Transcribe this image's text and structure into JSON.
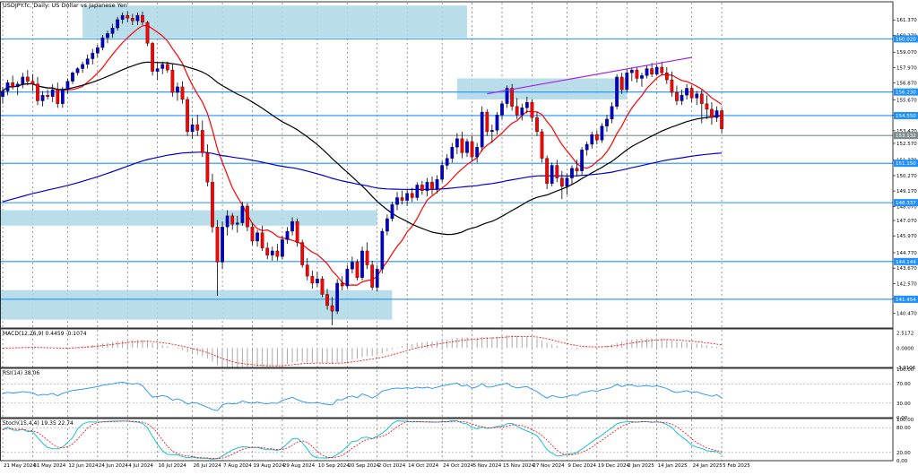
{
  "chart_data": {
    "type": "candlestick",
    "title": "USDJPY.fc, Daily: US Dollar vs Japanese Yen",
    "x_ticks": [
      "21 May 2024",
      "31 May 2024",
      "12 Jun 2024",
      "24 Jun 2024",
      "4 Jul 2024",
      "16 Jul 2024",
      "26 Jul 2024",
      "7 Aug 2024",
      "19 Aug 2024",
      "29 Aug 2024",
      "10 Sep 2024",
      "20 Sep 2024",
      "2 Oct 2024",
      "14 Oct 2024",
      "24 Oct 2024",
      "5 Nov 2024",
      "15 Nov 2024",
      "27 Nov 2024",
      "9 Dec 2024",
      "19 Dec 2024",
      "2 Jan 2025",
      "14 Jan 2025",
      "24 Jan 2025",
      "5 Feb 2025"
    ],
    "price_axis": {
      "ylim": [
        139.4,
        162.6
      ],
      "ticks": [
        "161.370",
        "160.270",
        "159.070",
        "157.970",
        "156.870",
        "155.670",
        "154.570",
        "153.470",
        "152.570",
        "151.370",
        "150.270",
        "149.170",
        "148.070",
        "147.070",
        "145.970",
        "144.770",
        "143.670",
        "142.570",
        "141.470",
        "140.470"
      ],
      "tagged_levels": [
        {
          "value": 160.02,
          "label": "160.020",
          "color": "#1e90ff"
        },
        {
          "value": 156.23,
          "label": "156.230",
          "color": "#1e90ff"
        },
        {
          "value": 154.55,
          "label": "154.550",
          "color": "#1e90ff"
        },
        {
          "value": 153.13,
          "label": "153.132",
          "color": "#7f8c8d"
        },
        {
          "value": 151.15,
          "label": "151.150",
          "color": "#1e90ff"
        },
        {
          "value": 148.34,
          "label": "148.337",
          "color": "#1e90ff"
        },
        {
          "value": 144.14,
          "label": "144.144",
          "color": "#1e90ff"
        },
        {
          "value": 141.45,
          "label": "141.454",
          "color": "#1e90ff"
        }
      ]
    },
    "zones": [
      {
        "from_idx": 16,
        "to_idx": 93,
        "low": 160.1,
        "high": 162.4
      },
      {
        "from_idx": -1,
        "to_idx": 75,
        "low": 146.7,
        "high": 147.8
      },
      {
        "from_idx": -1,
        "to_idx": 78,
        "low": 140.0,
        "high": 142.1
      },
      {
        "from_idx": 91,
        "to_idx": 125,
        "low": 155.7,
        "high": 157.2
      }
    ],
    "trendline": {
      "from_idx": 97,
      "from_value": 156.1,
      "to_idx": 138,
      "to_value": 158.7,
      "color": "#a020f0"
    },
    "candles": [
      {
        "o": 155.9,
        "h": 156.6,
        "l": 155.4,
        "c": 156.3
      },
      {
        "o": 156.3,
        "h": 157.1,
        "l": 156.0,
        "c": 156.9
      },
      {
        "o": 156.9,
        "h": 157.4,
        "l": 156.4,
        "c": 156.6
      },
      {
        "o": 156.6,
        "h": 157.0,
        "l": 156.0,
        "c": 156.8
      },
      {
        "o": 156.8,
        "h": 157.6,
        "l": 156.5,
        "c": 157.3
      },
      {
        "o": 157.3,
        "h": 157.8,
        "l": 156.7,
        "c": 157.0
      },
      {
        "o": 157.0,
        "h": 157.5,
        "l": 156.3,
        "c": 156.8
      },
      {
        "o": 156.8,
        "h": 157.3,
        "l": 155.3,
        "c": 155.6
      },
      {
        "o": 155.6,
        "h": 156.3,
        "l": 155.2,
        "c": 156.0
      },
      {
        "o": 156.0,
        "h": 156.4,
        "l": 155.7,
        "c": 155.9
      },
      {
        "o": 155.9,
        "h": 156.8,
        "l": 155.5,
        "c": 156.4
      },
      {
        "o": 156.4,
        "h": 156.9,
        "l": 155.1,
        "c": 155.4
      },
      {
        "o": 155.4,
        "h": 156.6,
        "l": 155.1,
        "c": 156.4
      },
      {
        "o": 156.4,
        "h": 157.2,
        "l": 156.1,
        "c": 157.0
      },
      {
        "o": 157.0,
        "h": 157.7,
        "l": 156.8,
        "c": 157.6
      },
      {
        "o": 157.6,
        "h": 158.0,
        "l": 157.4,
        "c": 157.9
      },
      {
        "o": 157.9,
        "h": 158.4,
        "l": 157.6,
        "c": 158.2
      },
      {
        "o": 158.2,
        "h": 158.9,
        "l": 157.9,
        "c": 158.6
      },
      {
        "o": 158.6,
        "h": 159.3,
        "l": 158.2,
        "c": 159.0
      },
      {
        "o": 159.0,
        "h": 159.6,
        "l": 158.7,
        "c": 159.4
      },
      {
        "o": 159.4,
        "h": 160.3,
        "l": 159.2,
        "c": 160.1
      },
      {
        "o": 160.1,
        "h": 160.6,
        "l": 159.7,
        "c": 160.4
      },
      {
        "o": 160.4,
        "h": 161.1,
        "l": 160.1,
        "c": 160.8
      },
      {
        "o": 160.8,
        "h": 161.6,
        "l": 160.6,
        "c": 161.4
      },
      {
        "o": 161.4,
        "h": 161.9,
        "l": 161.1,
        "c": 161.7
      },
      {
        "o": 161.7,
        "h": 162.0,
        "l": 161.2,
        "c": 161.5
      },
      {
        "o": 161.5,
        "h": 161.8,
        "l": 161.0,
        "c": 161.3
      },
      {
        "o": 161.3,
        "h": 161.9,
        "l": 161.0,
        "c": 161.7
      },
      {
        "o": 161.7,
        "h": 161.95,
        "l": 161.0,
        "c": 161.2
      },
      {
        "o": 161.2,
        "h": 161.3,
        "l": 159.5,
        "c": 159.7
      },
      {
        "o": 159.7,
        "h": 159.8,
        "l": 157.4,
        "c": 157.7
      },
      {
        "o": 157.7,
        "h": 158.3,
        "l": 157.1,
        "c": 157.9
      },
      {
        "o": 157.9,
        "h": 158.4,
        "l": 157.5,
        "c": 158.2
      },
      {
        "o": 158.2,
        "h": 158.4,
        "l": 157.6,
        "c": 157.8
      },
      {
        "o": 157.8,
        "h": 158.2,
        "l": 155.9,
        "c": 156.2
      },
      {
        "o": 156.2,
        "h": 156.9,
        "l": 155.6,
        "c": 156.6
      },
      {
        "o": 156.6,
        "h": 157.0,
        "l": 155.4,
        "c": 155.7
      },
      {
        "o": 155.7,
        "h": 155.9,
        "l": 153.1,
        "c": 153.4
      },
      {
        "o": 153.4,
        "h": 154.4,
        "l": 152.9,
        "c": 153.9
      },
      {
        "o": 153.9,
        "h": 154.6,
        "l": 153.1,
        "c": 153.5
      },
      {
        "o": 153.5,
        "h": 154.2,
        "l": 151.6,
        "c": 151.9
      },
      {
        "o": 151.9,
        "h": 152.5,
        "l": 149.5,
        "c": 149.8
      },
      {
        "o": 149.8,
        "h": 150.4,
        "l": 146.2,
        "c": 146.6
      },
      {
        "o": 146.6,
        "h": 147.1,
        "l": 141.7,
        "c": 144.1
      },
      {
        "o": 144.1,
        "h": 147.0,
        "l": 143.6,
        "c": 146.6
      },
      {
        "o": 146.6,
        "h": 147.8,
        "l": 146.0,
        "c": 147.4
      },
      {
        "o": 147.4,
        "h": 147.6,
        "l": 146.4,
        "c": 146.8
      },
      {
        "o": 146.8,
        "h": 147.4,
        "l": 146.2,
        "c": 146.9
      },
      {
        "o": 146.9,
        "h": 148.4,
        "l": 146.7,
        "c": 148.1
      },
      {
        "o": 148.1,
        "h": 148.3,
        "l": 146.3,
        "c": 146.6
      },
      {
        "o": 146.6,
        "h": 146.9,
        "l": 145.3,
        "c": 145.6
      },
      {
        "o": 145.6,
        "h": 146.4,
        "l": 145.2,
        "c": 146.2
      },
      {
        "o": 146.2,
        "h": 146.7,
        "l": 144.9,
        "c": 145.1
      },
      {
        "o": 145.1,
        "h": 145.5,
        "l": 144.3,
        "c": 144.6
      },
      {
        "o": 144.6,
        "h": 145.2,
        "l": 144.2,
        "c": 144.9
      },
      {
        "o": 144.9,
        "h": 145.4,
        "l": 144.2,
        "c": 144.5
      },
      {
        "o": 144.5,
        "h": 146.0,
        "l": 144.3,
        "c": 145.7
      },
      {
        "o": 145.7,
        "h": 146.6,
        "l": 145.4,
        "c": 146.3
      },
      {
        "o": 146.3,
        "h": 147.3,
        "l": 146.0,
        "c": 147.0
      },
      {
        "o": 147.0,
        "h": 147.2,
        "l": 145.2,
        "c": 145.5
      },
      {
        "o": 145.5,
        "h": 145.7,
        "l": 143.7,
        "c": 143.9
      },
      {
        "o": 143.9,
        "h": 144.4,
        "l": 142.8,
        "c": 143.1
      },
      {
        "o": 143.1,
        "h": 143.5,
        "l": 142.2,
        "c": 142.6
      },
      {
        "o": 142.6,
        "h": 143.4,
        "l": 142.3,
        "c": 142.9
      },
      {
        "o": 142.9,
        "h": 143.1,
        "l": 141.6,
        "c": 141.8
      },
      {
        "o": 141.8,
        "h": 142.2,
        "l": 140.7,
        "c": 141.0
      },
      {
        "o": 141.0,
        "h": 141.6,
        "l": 139.6,
        "c": 140.6
      },
      {
        "o": 140.6,
        "h": 142.9,
        "l": 140.4,
        "c": 142.6
      },
      {
        "o": 142.6,
        "h": 143.1,
        "l": 142.1,
        "c": 142.4
      },
      {
        "o": 142.4,
        "h": 143.9,
        "l": 142.2,
        "c": 143.6
      },
      {
        "o": 143.6,
        "h": 144.5,
        "l": 143.3,
        "c": 144.1
      },
      {
        "o": 144.1,
        "h": 144.3,
        "l": 142.8,
        "c": 143.0
      },
      {
        "o": 143.0,
        "h": 145.2,
        "l": 142.8,
        "c": 144.9
      },
      {
        "o": 144.9,
        "h": 145.5,
        "l": 143.6,
        "c": 143.9
      },
      {
        "o": 143.9,
        "h": 144.2,
        "l": 142.1,
        "c": 142.3
      },
      {
        "o": 142.3,
        "h": 143.9,
        "l": 142.0,
        "c": 143.6
      },
      {
        "o": 143.6,
        "h": 146.5,
        "l": 143.3,
        "c": 146.3
      },
      {
        "o": 146.3,
        "h": 147.5,
        "l": 146.0,
        "c": 147.2
      },
      {
        "o": 147.2,
        "h": 148.4,
        "l": 147.0,
        "c": 148.2
      },
      {
        "o": 148.2,
        "h": 149.1,
        "l": 147.8,
        "c": 148.7
      },
      {
        "o": 148.7,
        "h": 149.2,
        "l": 148.2,
        "c": 148.5
      },
      {
        "o": 148.5,
        "h": 149.3,
        "l": 148.1,
        "c": 149.0
      },
      {
        "o": 149.0,
        "h": 149.4,
        "l": 148.4,
        "c": 148.7
      },
      {
        "o": 148.7,
        "h": 149.8,
        "l": 148.5,
        "c": 149.6
      },
      {
        "o": 149.6,
        "h": 149.9,
        "l": 148.9,
        "c": 149.2
      },
      {
        "o": 149.2,
        "h": 150.1,
        "l": 148.8,
        "c": 149.8
      },
      {
        "o": 149.8,
        "h": 150.2,
        "l": 148.9,
        "c": 149.3
      },
      {
        "o": 149.3,
        "h": 150.3,
        "l": 149.0,
        "c": 150.0
      },
      {
        "o": 150.0,
        "h": 151.3,
        "l": 149.8,
        "c": 151.0
      },
      {
        "o": 151.0,
        "h": 151.8,
        "l": 150.7,
        "c": 151.5
      },
      {
        "o": 151.5,
        "h": 152.6,
        "l": 151.2,
        "c": 152.3
      },
      {
        "o": 152.3,
        "h": 153.3,
        "l": 151.8,
        "c": 152.9
      },
      {
        "o": 152.9,
        "h": 153.4,
        "l": 151.5,
        "c": 151.9
      },
      {
        "o": 151.9,
        "h": 152.9,
        "l": 151.6,
        "c": 152.7
      },
      {
        "o": 152.7,
        "h": 153.1,
        "l": 151.3,
        "c": 151.6
      },
      {
        "o": 151.6,
        "h": 152.6,
        "l": 151.2,
        "c": 152.3
      },
      {
        "o": 152.3,
        "h": 155.2,
        "l": 152.0,
        "c": 154.8
      },
      {
        "o": 154.8,
        "h": 155.0,
        "l": 153.1,
        "c": 153.4
      },
      {
        "o": 153.4,
        "h": 153.9,
        "l": 152.6,
        "c": 153.5
      },
      {
        "o": 153.5,
        "h": 154.8,
        "l": 153.2,
        "c": 154.6
      },
      {
        "o": 154.6,
        "h": 155.6,
        "l": 154.3,
        "c": 155.4
      },
      {
        "o": 155.4,
        "h": 156.7,
        "l": 155.1,
        "c": 156.5
      },
      {
        "o": 156.5,
        "h": 156.8,
        "l": 154.9,
        "c": 155.2
      },
      {
        "o": 155.2,
        "h": 155.8,
        "l": 154.3,
        "c": 154.6
      },
      {
        "o": 154.6,
        "h": 155.4,
        "l": 154.2,
        "c": 155.1
      },
      {
        "o": 155.1,
        "h": 155.9,
        "l": 154.7,
        "c": 155.5
      },
      {
        "o": 155.5,
        "h": 155.7,
        "l": 154.1,
        "c": 154.4
      },
      {
        "o": 154.4,
        "h": 154.8,
        "l": 153.1,
        "c": 153.4
      },
      {
        "o": 153.4,
        "h": 153.6,
        "l": 151.2,
        "c": 151.5
      },
      {
        "o": 151.5,
        "h": 151.7,
        "l": 149.3,
        "c": 149.7
      },
      {
        "o": 149.7,
        "h": 151.2,
        "l": 149.5,
        "c": 151.0
      },
      {
        "o": 151.0,
        "h": 151.4,
        "l": 149.8,
        "c": 150.1
      },
      {
        "o": 150.1,
        "h": 150.6,
        "l": 148.6,
        "c": 149.5
      },
      {
        "o": 149.5,
        "h": 150.4,
        "l": 148.9,
        "c": 150.1
      },
      {
        "o": 150.1,
        "h": 151.0,
        "l": 149.6,
        "c": 150.8
      },
      {
        "o": 150.8,
        "h": 151.4,
        "l": 150.2,
        "c": 150.6
      },
      {
        "o": 150.6,
        "h": 152.3,
        "l": 150.3,
        "c": 152.1
      },
      {
        "o": 152.1,
        "h": 152.7,
        "l": 151.7,
        "c": 152.5
      },
      {
        "o": 152.5,
        "h": 153.4,
        "l": 152.2,
        "c": 153.2
      },
      {
        "o": 153.2,
        "h": 153.5,
        "l": 152.5,
        "c": 152.8
      },
      {
        "o": 152.8,
        "h": 154.0,
        "l": 152.6,
        "c": 153.8
      },
      {
        "o": 153.8,
        "h": 154.6,
        "l": 153.4,
        "c": 154.3
      },
      {
        "o": 154.3,
        "h": 155.5,
        "l": 154.0,
        "c": 155.2
      },
      {
        "o": 155.2,
        "h": 157.5,
        "l": 155.0,
        "c": 157.3
      },
      {
        "o": 157.3,
        "h": 157.6,
        "l": 156.1,
        "c": 156.4
      },
      {
        "o": 156.4,
        "h": 157.9,
        "l": 156.2,
        "c": 157.6
      },
      {
        "o": 157.6,
        "h": 158.0,
        "l": 157.0,
        "c": 157.8
      },
      {
        "o": 157.8,
        "h": 158.0,
        "l": 156.9,
        "c": 157.2
      },
      {
        "o": 157.2,
        "h": 157.6,
        "l": 156.6,
        "c": 157.4
      },
      {
        "o": 157.4,
        "h": 158.1,
        "l": 157.2,
        "c": 157.9
      },
      {
        "o": 157.9,
        "h": 158.3,
        "l": 157.3,
        "c": 157.5
      },
      {
        "o": 157.5,
        "h": 158.2,
        "l": 157.4,
        "c": 158.0
      },
      {
        "o": 158.0,
        "h": 158.4,
        "l": 157.4,
        "c": 157.6
      },
      {
        "o": 157.6,
        "h": 158.0,
        "l": 156.8,
        "c": 157.1
      },
      {
        "o": 157.1,
        "h": 157.7,
        "l": 155.9,
        "c": 156.2
      },
      {
        "o": 156.2,
        "h": 156.7,
        "l": 155.3,
        "c": 155.6
      },
      {
        "o": 155.6,
        "h": 156.4,
        "l": 155.3,
        "c": 156.0
      },
      {
        "o": 156.0,
        "h": 156.8,
        "l": 155.7,
        "c": 156.5
      },
      {
        "o": 156.5,
        "h": 156.7,
        "l": 155.5,
        "c": 155.8
      },
      {
        "o": 155.8,
        "h": 156.3,
        "l": 155.3,
        "c": 156.1
      },
      {
        "o": 156.1,
        "h": 156.4,
        "l": 154.0,
        "c": 155.4
      },
      {
        "o": 155.4,
        "h": 156.0,
        "l": 154.3,
        "c": 155.0
      },
      {
        "o": 155.0,
        "h": 155.5,
        "l": 153.9,
        "c": 154.4
      },
      {
        "o": 154.4,
        "h": 155.2,
        "l": 154.1,
        "c": 154.9
      },
      {
        "o": 154.9,
        "h": 155.1,
        "l": 153.3,
        "c": 153.6
      }
    ],
    "moving_averages": [
      {
        "period": 10,
        "color": "#ff0000"
      },
      {
        "period": 50,
        "color": "#000000"
      },
      {
        "period": 200,
        "color": "#0000cd"
      }
    ],
    "macd": {
      "label": "MACD(12,26,9) 0.4459 -0.1074",
      "ylim": [
        -3.2,
        3.0
      ],
      "ticks": [
        "2.5172",
        "0.0000",
        "-3.9106"
      ],
      "hist_color": "#a9a9a9",
      "signal_color": "#ff0000"
    },
    "rsi": {
      "label": "RSI(14) 38.06",
      "ylim": [
        0,
        100
      ],
      "ticks": [
        "100.00",
        "70.00",
        "30.00",
        "0.00"
      ],
      "color": "#1e90ff"
    },
    "stoch": {
      "label": "Stoch(15,4,4) 19.35 22.74",
      "ylim": [
        0,
        100
      ],
      "ticks": [
        "100.00",
        "80.00",
        "20.00",
        "0.00"
      ],
      "main_color": "#00bcd4",
      "signal_color": "#ff0000"
    }
  }
}
